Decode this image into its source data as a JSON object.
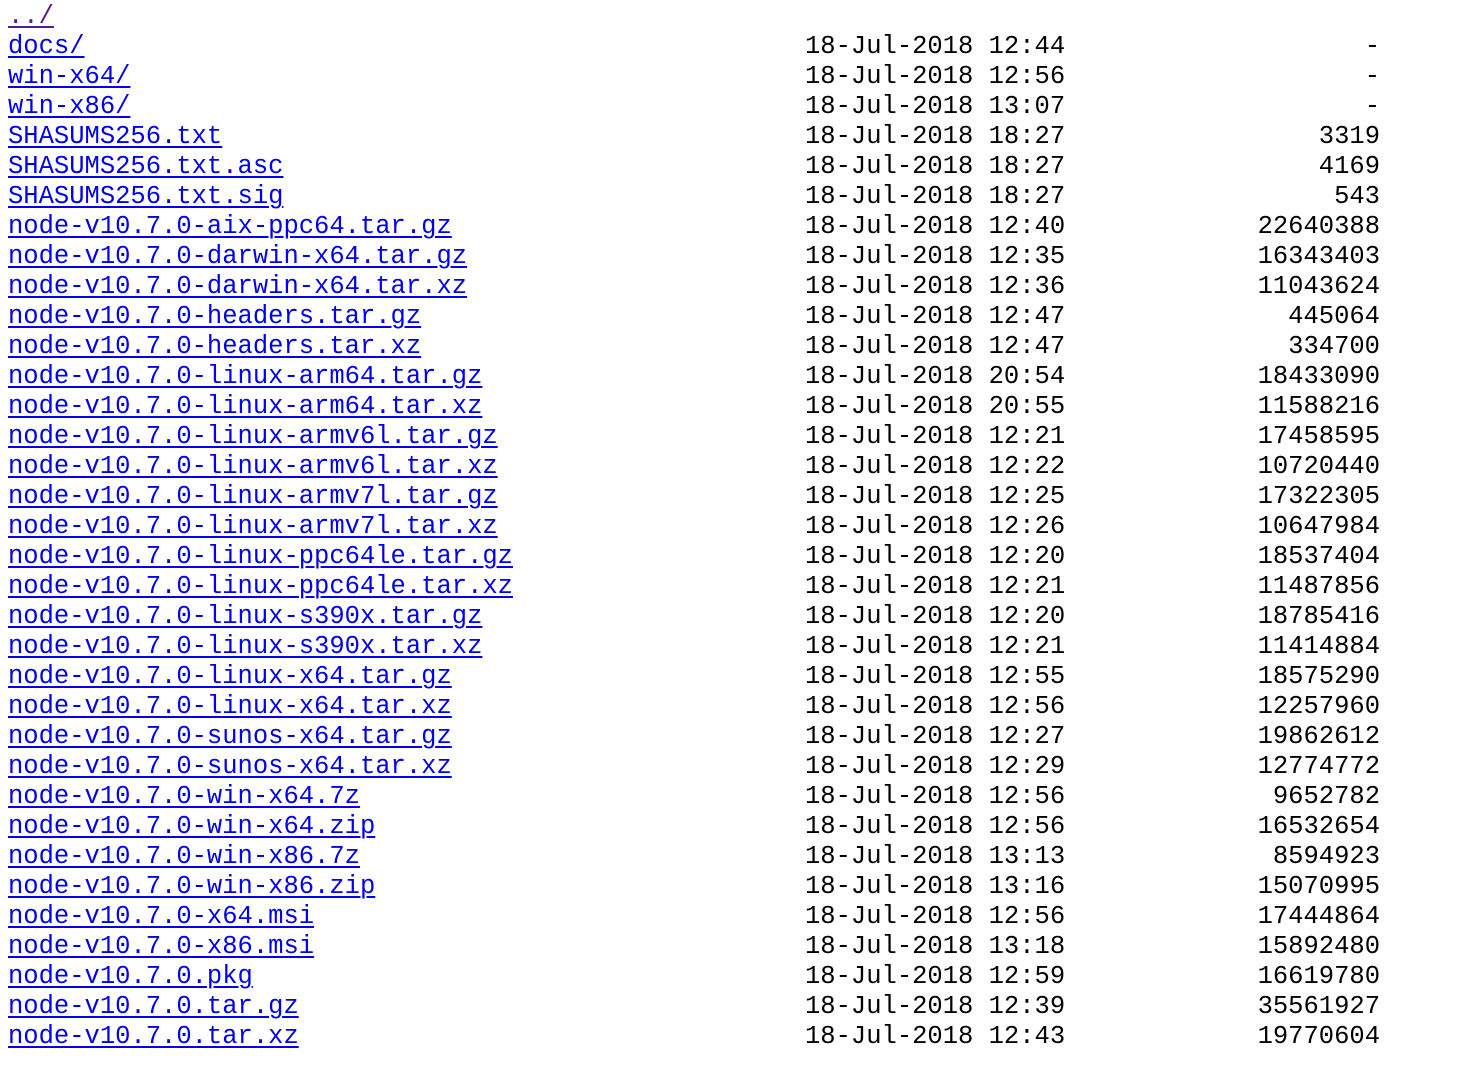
{
  "parent_link": {
    "label": "../"
  },
  "entries": [
    {
      "name": "docs/",
      "date": "18-Jul-2018 12:44",
      "size": "-"
    },
    {
      "name": "win-x64/",
      "date": "18-Jul-2018 12:56",
      "size": "-"
    },
    {
      "name": "win-x86/",
      "date": "18-Jul-2018 13:07",
      "size": "-"
    },
    {
      "name": "SHASUMS256.txt",
      "date": "18-Jul-2018 18:27",
      "size": "3319"
    },
    {
      "name": "SHASUMS256.txt.asc",
      "date": "18-Jul-2018 18:27",
      "size": "4169"
    },
    {
      "name": "SHASUMS256.txt.sig",
      "date": "18-Jul-2018 18:27",
      "size": "543"
    },
    {
      "name": "node-v10.7.0-aix-ppc64.tar.gz",
      "date": "18-Jul-2018 12:40",
      "size": "22640388"
    },
    {
      "name": "node-v10.7.0-darwin-x64.tar.gz",
      "date": "18-Jul-2018 12:35",
      "size": "16343403"
    },
    {
      "name": "node-v10.7.0-darwin-x64.tar.xz",
      "date": "18-Jul-2018 12:36",
      "size": "11043624"
    },
    {
      "name": "node-v10.7.0-headers.tar.gz",
      "date": "18-Jul-2018 12:47",
      "size": "445064"
    },
    {
      "name": "node-v10.7.0-headers.tar.xz",
      "date": "18-Jul-2018 12:47",
      "size": "334700"
    },
    {
      "name": "node-v10.7.0-linux-arm64.tar.gz",
      "date": "18-Jul-2018 20:54",
      "size": "18433090"
    },
    {
      "name": "node-v10.7.0-linux-arm64.tar.xz",
      "date": "18-Jul-2018 20:55",
      "size": "11588216"
    },
    {
      "name": "node-v10.7.0-linux-armv6l.tar.gz",
      "date": "18-Jul-2018 12:21",
      "size": "17458595"
    },
    {
      "name": "node-v10.7.0-linux-armv6l.tar.xz",
      "date": "18-Jul-2018 12:22",
      "size": "10720440"
    },
    {
      "name": "node-v10.7.0-linux-armv7l.tar.gz",
      "date": "18-Jul-2018 12:25",
      "size": "17322305"
    },
    {
      "name": "node-v10.7.0-linux-armv7l.tar.xz",
      "date": "18-Jul-2018 12:26",
      "size": "10647984"
    },
    {
      "name": "node-v10.7.0-linux-ppc64le.tar.gz",
      "date": "18-Jul-2018 12:20",
      "size": "18537404"
    },
    {
      "name": "node-v10.7.0-linux-ppc64le.tar.xz",
      "date": "18-Jul-2018 12:21",
      "size": "11487856"
    },
    {
      "name": "node-v10.7.0-linux-s390x.tar.gz",
      "date": "18-Jul-2018 12:20",
      "size": "18785416"
    },
    {
      "name": "node-v10.7.0-linux-s390x.tar.xz",
      "date": "18-Jul-2018 12:21",
      "size": "11414884"
    },
    {
      "name": "node-v10.7.0-linux-x64.tar.gz",
      "date": "18-Jul-2018 12:55",
      "size": "18575290"
    },
    {
      "name": "node-v10.7.0-linux-x64.tar.xz",
      "date": "18-Jul-2018 12:56",
      "size": "12257960"
    },
    {
      "name": "node-v10.7.0-sunos-x64.tar.gz",
      "date": "18-Jul-2018 12:27",
      "size": "19862612"
    },
    {
      "name": "node-v10.7.0-sunos-x64.tar.xz",
      "date": "18-Jul-2018 12:29",
      "size": "12774772"
    },
    {
      "name": "node-v10.7.0-win-x64.7z",
      "date": "18-Jul-2018 12:56",
      "size": "9652782"
    },
    {
      "name": "node-v10.7.0-win-x64.zip",
      "date": "18-Jul-2018 12:56",
      "size": "16532654"
    },
    {
      "name": "node-v10.7.0-win-x86.7z",
      "date": "18-Jul-2018 13:13",
      "size": "8594923"
    },
    {
      "name": "node-v10.7.0-win-x86.zip",
      "date": "18-Jul-2018 13:16",
      "size": "15070995"
    },
    {
      "name": "node-v10.7.0-x64.msi",
      "date": "18-Jul-2018 12:56",
      "size": "17444864"
    },
    {
      "name": "node-v10.7.0-x86.msi",
      "date": "18-Jul-2018 13:18",
      "size": "15892480"
    },
    {
      "name": "node-v10.7.0.pkg",
      "date": "18-Jul-2018 12:59",
      "size": "16619780"
    },
    {
      "name": "node-v10.7.0.tar.gz",
      "date": "18-Jul-2018 12:39",
      "size": "35561927"
    },
    {
      "name": "node-v10.7.0.tar.xz",
      "date": "18-Jul-2018 12:43",
      "size": "19770604"
    }
  ],
  "colors": {
    "link": "#0000ee",
    "visited_link": "#551a8b",
    "text": "#000000",
    "background": "#ffffff"
  }
}
